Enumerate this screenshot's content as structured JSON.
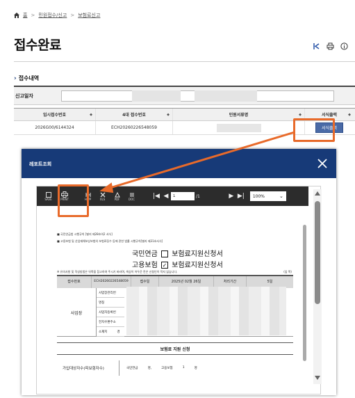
{
  "breadcrumb": {
    "home": "홈",
    "level1": "민원접수/신고",
    "level2": "보험료신고"
  },
  "page": {
    "title": "접수완료"
  },
  "section": {
    "title": "접수내역"
  },
  "search": {
    "label": "신고일자"
  },
  "grid": {
    "headers": [
      "임시접수번호",
      "4대 접수번호",
      "민원서류명",
      "서식출력"
    ],
    "sort_mark": "◆",
    "rows": [
      {
        "temp_no": "2026G00/6144324",
        "no4": "ECH20260226548059",
        "doc_name": "",
        "action": "서식출력"
      }
    ]
  },
  "modal": {
    "title": "레포트조회",
    "toolbar": {
      "buttons": [
        "SAVE",
        "PRINT",
        "HWP",
        "XLS",
        "PDF",
        "DOC"
      ],
      "page_current": "1",
      "page_total": "/1",
      "zoom": "100%"
    }
  },
  "document": {
    "note1": "■ 국민연금법 시행규칙 [별지 제28호의2 서식]",
    "note2": "■ 고용보험 및 산업재해보상보험의 보험료징수 등에 관한 법률 시행규칙[별지 제31호서식]",
    "title_line1_a": "국민연금",
    "title_line1_b": "보험료지원신청서",
    "title_line2_a": "고용보험",
    "title_line2_b": "보험료지원신청서",
    "check_mark": "✓",
    "sub_note": "※ 유의사항 및 작성방법은 뒤쪽을 참고하여 주시기 바라며, 색상이 어두운 란은 신청인이 적지 않습니다.",
    "sub_right": "(앞 쪽)",
    "table": {
      "receipt_label": "접수번호",
      "receipt_value": "ECH20260226548059",
      "date_label": "접수일",
      "date_value": "2025년 02월 26일",
      "period_label": "처리기간",
      "period_value": "5일"
    },
    "business": {
      "label": "사업장",
      "sub_labels": [
        "사업장관리번",
        "명칭",
        "사업자등록번",
        "전자우편주소",
        "소재지"
      ],
      "address_fragment": "경"
    },
    "section_title": "보험료 지원 신청",
    "bottom": {
      "label": "가입대상자수(피보험자수)",
      "pension": "국민연금",
      "pension_unit": "명,",
      "employ": "고용보험",
      "employ_count": "1",
      "employ_unit": "명"
    }
  },
  "colors": {
    "header_blue": "#173a78",
    "highlight": "#e86a2a",
    "button_blue": "#4a6aa6"
  }
}
